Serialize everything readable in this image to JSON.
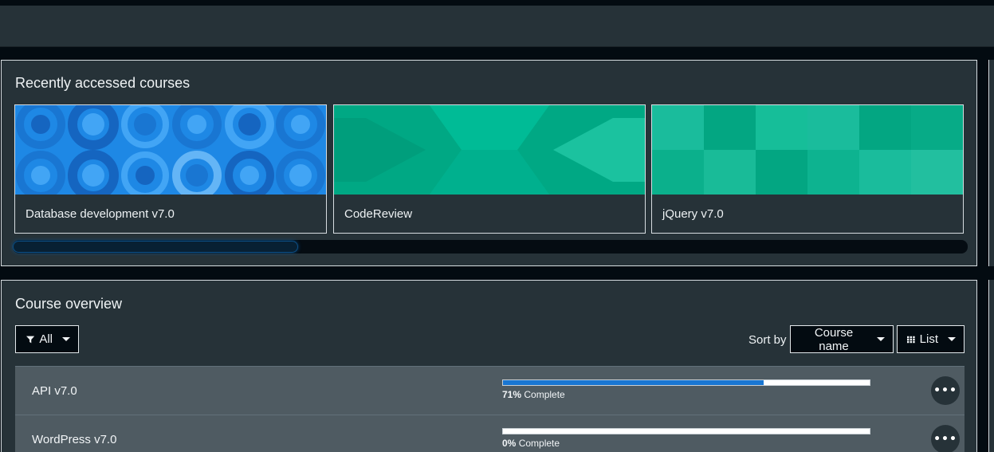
{
  "recent": {
    "title": "Recently accessed courses",
    "courses": [
      {
        "name": "Database development v7.0",
        "image_color": "#1e88e5"
      },
      {
        "name": "CodeReview",
        "image_color": "#00b894"
      },
      {
        "name": "jQuery v7.0",
        "image_color": "#1abc9c"
      }
    ]
  },
  "overview": {
    "title": "Course overview",
    "filter_label": "All",
    "sort_by_label": "Sort by",
    "sort_value": "Course name",
    "view_label": "List",
    "courses": [
      {
        "name": "API v7.0",
        "progress_percent": 71,
        "percent_text": "71%",
        "complete_text": "Complete"
      },
      {
        "name": "WordPress v7.0",
        "progress_percent": 0,
        "percent_text": "0%",
        "complete_text": "Complete"
      }
    ]
  },
  "icons": {
    "filter": "filter-icon",
    "list_view": "grid-icon",
    "more": "more-horizontal-icon",
    "dropdown": "caret-down-icon"
  },
  "colors": {
    "page_bg": "#030b11",
    "card_bg": "#263238",
    "progress_fill": "#1976d2",
    "row_bg": "#4f5b62"
  }
}
